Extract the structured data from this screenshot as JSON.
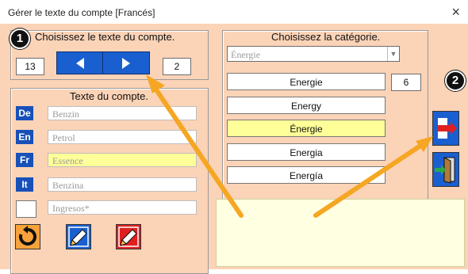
{
  "window": {
    "title": "Gérer le texte du compte   [Francés]",
    "close_glyph": "×"
  },
  "account_group": {
    "badge": "1",
    "title": "Choisissez le texte du compte.",
    "current_index": "13",
    "total": "2"
  },
  "text_group": {
    "title": "Texte du compte.",
    "rows": [
      {
        "lang": "De",
        "value": "Benzin"
      },
      {
        "lang": "En",
        "value": "Petrol"
      },
      {
        "lang": "Fr",
        "value": "Essence"
      },
      {
        "lang": "It",
        "value": "Benzina"
      },
      {
        "lang": "",
        "value": "Ingresos*"
      }
    ]
  },
  "category_group": {
    "title": "Choisissez la catégorie.",
    "dropdown_value": "Énergie",
    "count": "6",
    "items": [
      "Energie",
      "Energy",
      "Énergie",
      "Energia",
      "Energía"
    ],
    "selected_index": 2
  },
  "side": {
    "badge": "2"
  },
  "colors": {
    "background": "#fbd3b7",
    "accent_blue": "#1a5fd0",
    "highlight": "#ffff99",
    "arrow": "#f5a623",
    "notes": "#ffffe1"
  },
  "icons": {
    "prev": "arrow-left-icon",
    "next": "arrow-right-icon",
    "reset": "refresh-icon",
    "edit_blue": "pencil-icon",
    "edit_red": "pencil-icon",
    "transfer": "transfer-icon",
    "exit": "exit-door-icon"
  }
}
